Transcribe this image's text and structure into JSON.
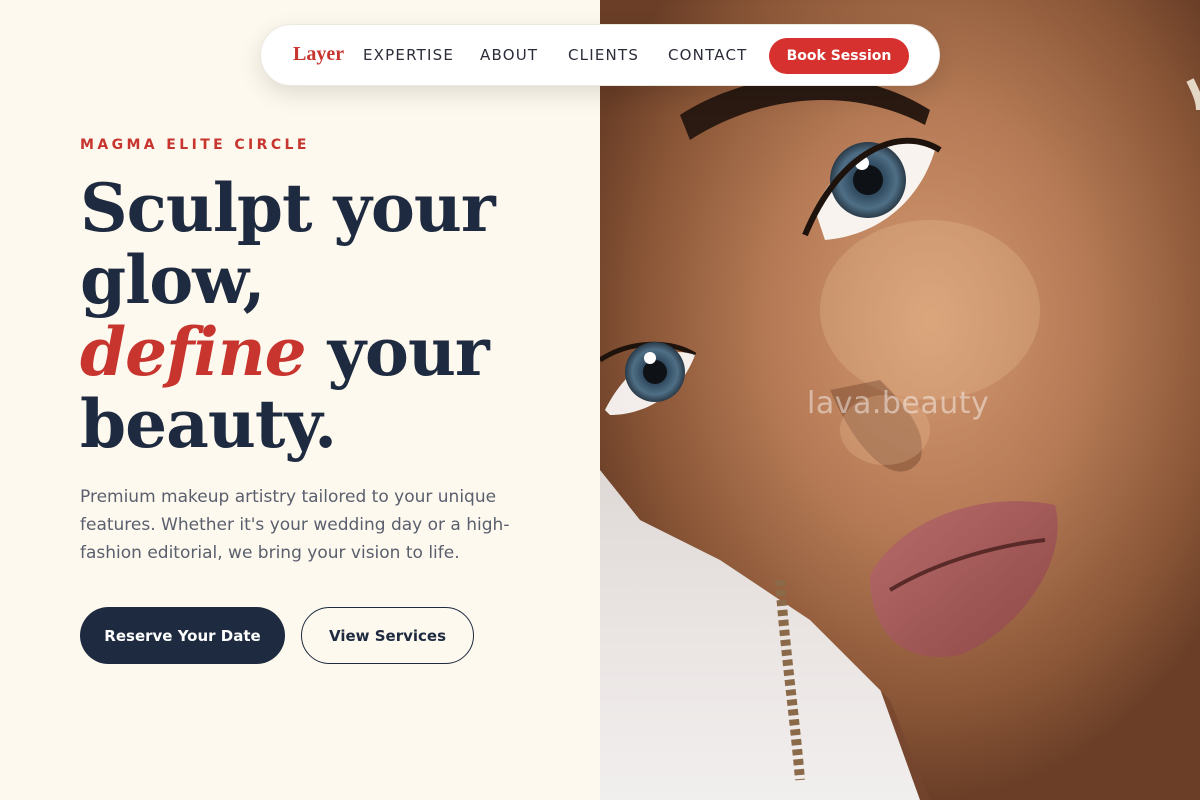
{
  "nav": {
    "logo": "Layer",
    "links": [
      "EXPERTISE",
      "ABOUT",
      "CLIENTS",
      "CONTACT"
    ],
    "cta_label": "Book Session"
  },
  "hero": {
    "eyebrow": "MAGMA ELITE CIRCLE",
    "headline_1": "Sculpt your",
    "headline_2": "glow,",
    "headline_accent": "define",
    "headline_3": " your",
    "headline_4": "beauty.",
    "description": "Premium makeup artistry tailored to your unique features. Whether it's your wedding day or a high-fashion editorial, we bring your vision to life.",
    "primary_cta": "Reserve Your Date",
    "secondary_cta": "View Services"
  },
  "image": {
    "watermark": "lava.beauty"
  },
  "colors": {
    "accent": "#c8352f",
    "navy": "#1e2a3f",
    "cream": "#fdf9ee",
    "cta_red": "#d6312f"
  }
}
